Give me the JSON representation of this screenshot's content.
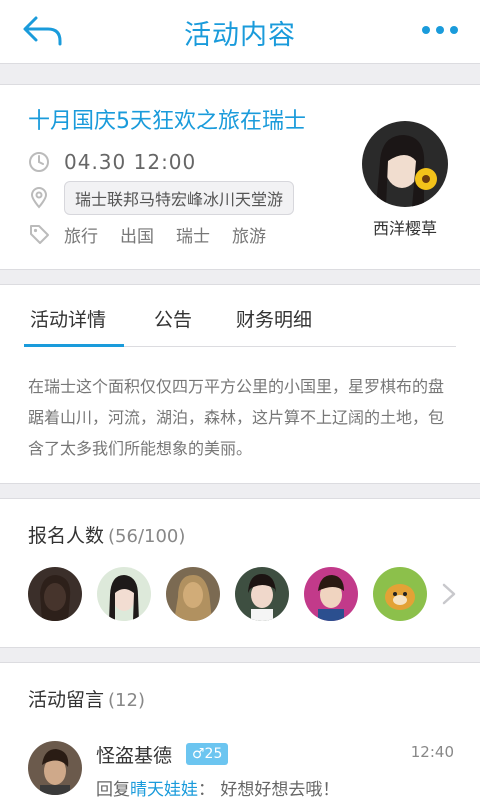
{
  "header": {
    "title": "活动内容",
    "back_icon": "back-arrow-icon",
    "more_icon": "more-dots-icon"
  },
  "event": {
    "title": "十月国庆5天狂欢之旅在瑞士",
    "time": "04.30 12:00",
    "location": "瑞士联邦马特宏峰冰川天堂游",
    "tags": [
      "旅行",
      "出国",
      "瑞士",
      "旅游"
    ],
    "host_name": "西洋樱草"
  },
  "tabs": [
    {
      "label": "活动详情",
      "active": true
    },
    {
      "label": "公告",
      "active": false
    },
    {
      "label": "财务明细",
      "active": false
    }
  ],
  "description": "在瑞士这个面积仅仅四万平方公里的小国里，星罗棋布的盘踞着山川，河流，湖泊，森林，这片算不上辽阔的土地，包含了太多我们所能想象的美丽。",
  "signups": {
    "label": "报名人数",
    "count": "(56/100)"
  },
  "comments": {
    "label": "活动留言",
    "count": "(12)",
    "items": [
      {
        "user": "怪盗基德",
        "gender_age": "♂25",
        "time": "12:40",
        "reply_prefix": "回复",
        "reply_to": "晴天娃娃",
        "text": "：  好想好想去哦！"
      }
    ]
  },
  "colors": {
    "accent": "#1a9bdb",
    "background": "#eeeef1",
    "badge": "#6cc5f0"
  }
}
